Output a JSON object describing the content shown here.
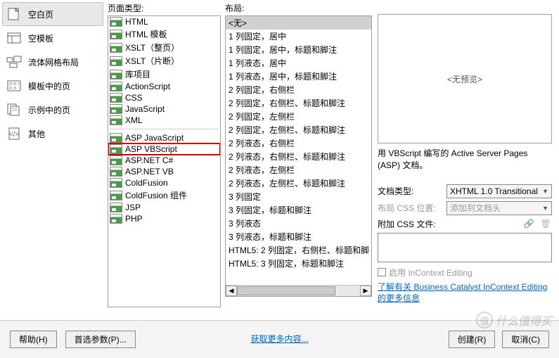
{
  "categories": {
    "label_section": "",
    "items": [
      {
        "label": "空白页",
        "selected": true
      },
      {
        "label": "空模板",
        "selected": false
      },
      {
        "label": "流体网格布局",
        "selected": false
      },
      {
        "label": "模板中的页",
        "selected": false
      },
      {
        "label": "示例中的页",
        "selected": false
      },
      {
        "label": "其他",
        "selected": false
      }
    ]
  },
  "page_types": {
    "header": "页面类型:",
    "group1": [
      "HTML",
      "HTML 模板",
      "XSLT（整页）",
      "XSLT（片断）",
      "库项目",
      "ActionScript",
      "CSS",
      "JavaScript",
      "XML"
    ],
    "group2": [
      "ASP JavaScript",
      "ASP VBScript",
      "ASP.NET C#",
      "ASP.NET VB",
      "ColdFusion",
      "ColdFusion 组件",
      "JSP",
      "PHP"
    ],
    "selected": "ASP VBScript"
  },
  "layouts": {
    "header": "布局:",
    "items": [
      "<无>",
      "1 列固定，居中",
      "1 列固定，居中，标题和脚注",
      "1 列液态，居中",
      "1 列液态，居中，标题和脚注",
      "2 列固定，右侧栏",
      "2 列固定，右侧栏、标题和脚注",
      "2 列固定，左侧栏",
      "2 列固定，左侧栏、标题和脚注",
      "2 列液态，右侧栏",
      "2 列液态，右侧栏、标题和脚注",
      "2 列液态，左侧栏",
      "2 列液态，左侧栏、标题和脚注",
      "3 列固定",
      "3 列固定，标题和脚注",
      "3 列液态",
      "3 列液态，标题和脚注",
      "HTML5: 2 列固定，右侧栏、标题和脚",
      "HTML5: 3 列固定，标题和脚注"
    ],
    "selected": "<无>"
  },
  "preview": {
    "placeholder": "<无预览>",
    "description": "用 VBScript 编写的 Active Server Pages (ASP) 文档。"
  },
  "form": {
    "doctype_label": "文档类型:",
    "doctype_value": "XHTML 1.0 Transitional",
    "css_pos_label": "布局 CSS 位置:",
    "css_pos_value": "添加到文档头",
    "attach_label": "附加 CSS 文件:",
    "incontext_label": "启用 InContext Editing",
    "incontext_link": "了解有关 Business Catalyst InContext Editing 的更多信息"
  },
  "footer": {
    "help": "帮助(H)",
    "prefs": "首选参数(P)...",
    "more_link": "获取更多内容...",
    "create": "创建(R)",
    "cancel": "取消(C)"
  },
  "watermark": "什么值得买"
}
